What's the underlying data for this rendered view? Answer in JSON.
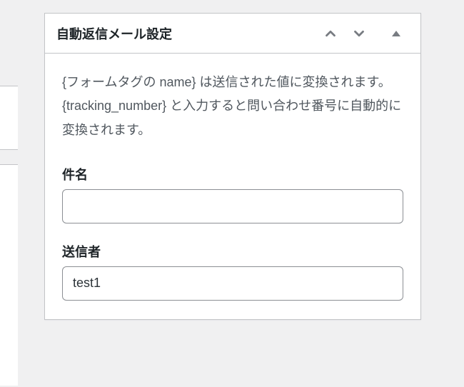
{
  "panel": {
    "title": "自動返信メール設定",
    "description": "{フォームタグの name} は送信された値に変換されます。 {tracking_number} と入力すると問い合わせ番号に自動的に変換されます。"
  },
  "fields": {
    "subject": {
      "label": "件名",
      "value": ""
    },
    "sender": {
      "label": "送信者",
      "value": "test1"
    }
  }
}
